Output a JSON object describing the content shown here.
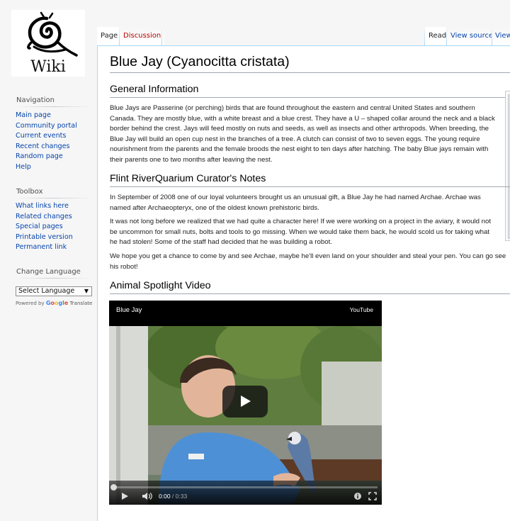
{
  "logo": {
    "text": "Wiki"
  },
  "sidebar": {
    "navigation": {
      "heading": "Navigation",
      "items": [
        "Main page",
        "Community portal",
        "Current events",
        "Recent changes",
        "Random page",
        "Help"
      ]
    },
    "toolbox": {
      "heading": "Toolbox",
      "items": [
        "What links here",
        "Related changes",
        "Special pages",
        "Printable version",
        "Permanent link"
      ]
    },
    "language": {
      "heading": "Change Language",
      "select_value": "Select Language",
      "powered_by": "Powered by",
      "google_letters": [
        "G",
        "o",
        "o",
        "g",
        "l",
        "e"
      ],
      "translate": "Translate"
    }
  },
  "tabs": {
    "left": [
      {
        "label": "Page",
        "selected": true
      },
      {
        "label": "Discussion",
        "selected": false
      }
    ],
    "right": [
      {
        "label": "Read",
        "selected": true
      },
      {
        "label": "View source",
        "selected": false
      },
      {
        "label": "View",
        "selected": false
      }
    ]
  },
  "article": {
    "title": "Blue Jay (Cyanocitta cristata)",
    "sections": [
      {
        "heading": "General Information",
        "paragraphs": [
          "Blue Jays are Passerine (or perching) birds that are found throughout the eastern and central United States and southern Canada. They are mostly blue, with a white breast and a blue crest. They have a U – shaped collar around the neck and a black border behind the crest. Jays will feed mostly on nuts and seeds, as well as insects and other arthropods. When breeding, the Blue Jay will build an open cup nest in the branches of a tree. A clutch can consist of two to seven eggs. The young require nourishment from the parents and the female broods the nest eight to ten days after hatching. The baby Blue jays remain with their parents one to two months after leaving the nest."
        ]
      },
      {
        "heading": "Flint RiverQuarium Curator's Notes",
        "paragraphs": [
          "In September of 2008 one of our loyal volunteers brought us an unusual gift, a Blue Jay he had named Archae. Archae was named after Archaeopteryx, one of the oldest known prehistoric birds.",
          "It was not long before we realized that we had quite a character here! If we were working on a project in the aviary, it would not be uncommon for small nuts, bolts and tools to go missing. When we would take them back, he would scold us for taking what he had stolen! Some of the staff had decided that he was building a robot.",
          "We hope you get a chance to come by and see Archae, maybe he'll even land on your shoulder and steal your pen. You can go see his robot!"
        ]
      },
      {
        "heading": "Animal Spotlight Video",
        "paragraphs": []
      }
    ]
  },
  "video": {
    "title": "Blue Jay",
    "brand": "YouTube",
    "current_time": "0:00",
    "separator": " / ",
    "duration": "0:33",
    "progress_fraction": 0
  },
  "icons": {
    "play": "play-icon",
    "volume": "volume-icon",
    "info": "info-icon",
    "fullscreen": "fullscreen-icon"
  }
}
